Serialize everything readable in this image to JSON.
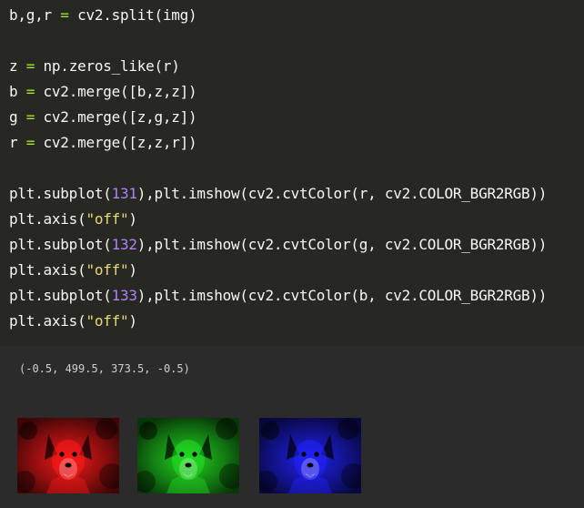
{
  "code_lines": [
    [
      {
        "t": "b,g,r "
      },
      {
        "t": "=",
        "c": "op"
      },
      {
        "t": " cv2.split(img)"
      }
    ],
    [],
    [
      {
        "t": "z "
      },
      {
        "t": "=",
        "c": "op"
      },
      {
        "t": " np.zeros_like(r)"
      }
    ],
    [
      {
        "t": "b "
      },
      {
        "t": "=",
        "c": "op"
      },
      {
        "t": " cv2.merge([b,z,z])"
      }
    ],
    [
      {
        "t": "g "
      },
      {
        "t": "=",
        "c": "op"
      },
      {
        "t": " cv2.merge([z,g,z])"
      }
    ],
    [
      {
        "t": "r "
      },
      {
        "t": "=",
        "c": "op"
      },
      {
        "t": " cv2.merge([z,z,r])"
      }
    ],
    [],
    [
      {
        "t": "plt.subplot("
      },
      {
        "t": "131",
        "c": "num"
      },
      {
        "t": "),plt.imshow(cv2.cvtColor(r, cv2.COLOR_BGR2RGB))"
      }
    ],
    [
      {
        "t": "plt.axis("
      },
      {
        "t": "\"off\"",
        "c": "str"
      },
      {
        "t": ")"
      }
    ],
    [
      {
        "t": "plt.subplot("
      },
      {
        "t": "132",
        "c": "num"
      },
      {
        "t": "),plt.imshow(cv2.cvtColor(g, cv2.COLOR_BGR2RGB))"
      }
    ],
    [
      {
        "t": "plt.axis("
      },
      {
        "t": "\"off\"",
        "c": "str"
      },
      {
        "t": ")"
      }
    ],
    [
      {
        "t": "plt.subplot("
      },
      {
        "t": "133",
        "c": "num"
      },
      {
        "t": "),plt.imshow(cv2.cvtColor(b, cv2.COLOR_BGR2RGB))"
      }
    ],
    [
      {
        "t": "plt.axis("
      },
      {
        "t": "\"off\"",
        "c": "str"
      },
      {
        "t": ")"
      }
    ]
  ],
  "output": {
    "text": "(-0.5, 499.5, 373.5, -0.5)",
    "thumbnails": [
      {
        "channel": "red",
        "color": "#ff1a1a"
      },
      {
        "channel": "green",
        "color": "#22e022"
      },
      {
        "channel": "blue",
        "color": "#2222ff"
      }
    ]
  },
  "colors": {
    "editor_bg": "#272822",
    "output_bg": "#2b2b2b",
    "operator": "#a6e22e",
    "number": "#ae81ff",
    "string": "#e6db74"
  }
}
